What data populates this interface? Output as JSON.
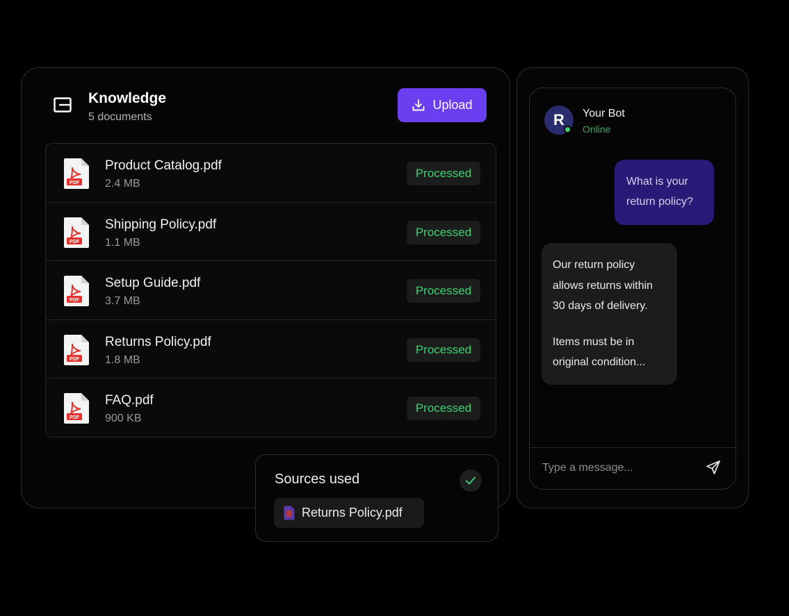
{
  "knowledge": {
    "title": "Knowledge",
    "subtitle": "5 documents",
    "upload_label": "Upload",
    "documents": [
      {
        "name": "Product Catalog.pdf",
        "size": "2.4 MB",
        "status": "Processed"
      },
      {
        "name": "Shipping Policy.pdf",
        "size": "1.1 MB",
        "status": "Processed"
      },
      {
        "name": "Setup Guide.pdf",
        "size": "3.7 MB",
        "status": "Processed"
      },
      {
        "name": "Returns Policy.pdf",
        "size": "1.8 MB",
        "status": "Processed"
      },
      {
        "name": "FAQ.pdf",
        "size": "900 KB",
        "status": "Processed"
      }
    ]
  },
  "sources": {
    "title": "Sources used",
    "file": "Returns Policy.pdf"
  },
  "chat": {
    "avatar_letter": "R",
    "bot_name": "Your Bot",
    "status": "Online",
    "user_message": "What is your return policy?",
    "bot_message_p1": "Our return policy allows returns within 30 days of delivery.",
    "bot_message_p2": "Items must be in original condition...",
    "input_placeholder": "Type a message..."
  },
  "colors": {
    "accent": "#6a3ff0",
    "success": "#3fcf75",
    "user_bubble": "#2a1a78",
    "pdf_red": "#e5322d"
  }
}
